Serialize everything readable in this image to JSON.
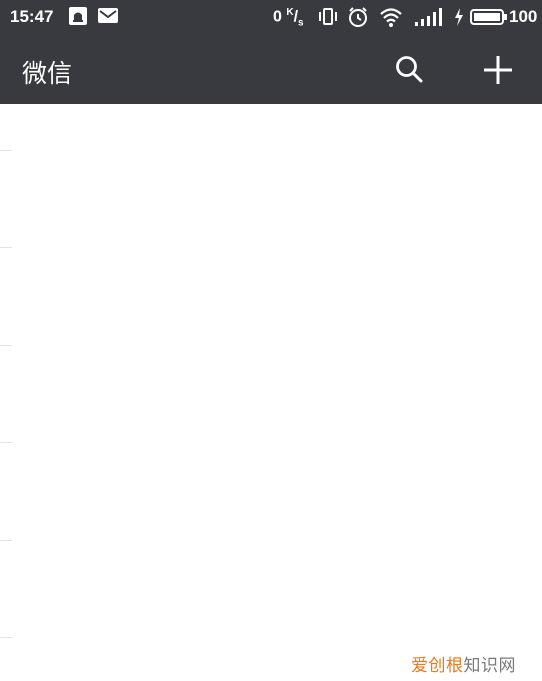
{
  "status_bar": {
    "time": "15:47",
    "net_value": "0",
    "net_unit_top": "K",
    "net_unit_bottom": "s",
    "battery_text": "100",
    "icons": [
      "notification-icon",
      "mail-icon",
      "vibrate-icon",
      "alarm-icon",
      "wifi-icon",
      "signal-icon",
      "charging-icon",
      "battery-icon"
    ]
  },
  "app_bar": {
    "title": "微信",
    "actions": [
      "search-icon",
      "add-icon"
    ]
  },
  "watermark": {
    "part1": "爱创根",
    "part2": "知识网"
  },
  "colors": {
    "toolbar": "#393a3f",
    "background": "#ffffff",
    "watermark_accent": "#e67a1c",
    "watermark_gray": "#7a7a7a"
  }
}
